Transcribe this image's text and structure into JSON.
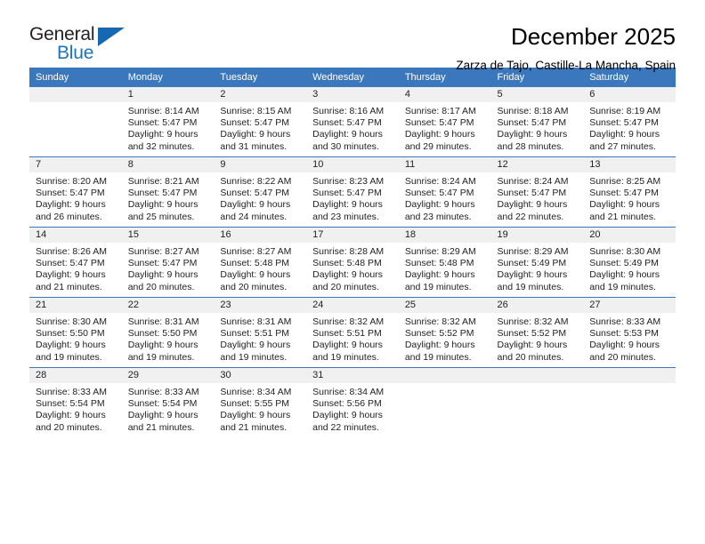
{
  "logo": {
    "primary_text": "General",
    "secondary_text": "Blue",
    "primary_color": "#231f20",
    "secondary_color": "#1b75bb",
    "triangle_color": "#1668b3"
  },
  "header": {
    "title": "December 2025",
    "subtitle": "Zarza de Tajo, Castille-La Mancha, Spain"
  },
  "theme": {
    "header_bg": "#3b77bd",
    "header_text": "#ffffff",
    "daynum_band_bg": "#f0f0f0",
    "cell_bg": "#ffffff",
    "text": "#222222"
  },
  "weekday_headers": [
    "Sunday",
    "Monday",
    "Tuesday",
    "Wednesday",
    "Thursday",
    "Friday",
    "Saturday"
  ],
  "weeks": [
    [
      {
        "day": "",
        "lines": []
      },
      {
        "day": "1",
        "lines": [
          "Sunrise: 8:14 AM",
          "Sunset: 5:47 PM",
          "Daylight: 9 hours",
          "and 32 minutes."
        ]
      },
      {
        "day": "2",
        "lines": [
          "Sunrise: 8:15 AM",
          "Sunset: 5:47 PM",
          "Daylight: 9 hours",
          "and 31 minutes."
        ]
      },
      {
        "day": "3",
        "lines": [
          "Sunrise: 8:16 AM",
          "Sunset: 5:47 PM",
          "Daylight: 9 hours",
          "and 30 minutes."
        ]
      },
      {
        "day": "4",
        "lines": [
          "Sunrise: 8:17 AM",
          "Sunset: 5:47 PM",
          "Daylight: 9 hours",
          "and 29 minutes."
        ]
      },
      {
        "day": "5",
        "lines": [
          "Sunrise: 8:18 AM",
          "Sunset: 5:47 PM",
          "Daylight: 9 hours",
          "and 28 minutes."
        ]
      },
      {
        "day": "6",
        "lines": [
          "Sunrise: 8:19 AM",
          "Sunset: 5:47 PM",
          "Daylight: 9 hours",
          "and 27 minutes."
        ]
      }
    ],
    [
      {
        "day": "7",
        "lines": [
          "Sunrise: 8:20 AM",
          "Sunset: 5:47 PM",
          "Daylight: 9 hours",
          "and 26 minutes."
        ]
      },
      {
        "day": "8",
        "lines": [
          "Sunrise: 8:21 AM",
          "Sunset: 5:47 PM",
          "Daylight: 9 hours",
          "and 25 minutes."
        ]
      },
      {
        "day": "9",
        "lines": [
          "Sunrise: 8:22 AM",
          "Sunset: 5:47 PM",
          "Daylight: 9 hours",
          "and 24 minutes."
        ]
      },
      {
        "day": "10",
        "lines": [
          "Sunrise: 8:23 AM",
          "Sunset: 5:47 PM",
          "Daylight: 9 hours",
          "and 23 minutes."
        ]
      },
      {
        "day": "11",
        "lines": [
          "Sunrise: 8:24 AM",
          "Sunset: 5:47 PM",
          "Daylight: 9 hours",
          "and 23 minutes."
        ]
      },
      {
        "day": "12",
        "lines": [
          "Sunrise: 8:24 AM",
          "Sunset: 5:47 PM",
          "Daylight: 9 hours",
          "and 22 minutes."
        ]
      },
      {
        "day": "13",
        "lines": [
          "Sunrise: 8:25 AM",
          "Sunset: 5:47 PM",
          "Daylight: 9 hours",
          "and 21 minutes."
        ]
      }
    ],
    [
      {
        "day": "14",
        "lines": [
          "Sunrise: 8:26 AM",
          "Sunset: 5:47 PM",
          "Daylight: 9 hours",
          "and 21 minutes."
        ]
      },
      {
        "day": "15",
        "lines": [
          "Sunrise: 8:27 AM",
          "Sunset: 5:47 PM",
          "Daylight: 9 hours",
          "and 20 minutes."
        ]
      },
      {
        "day": "16",
        "lines": [
          "Sunrise: 8:27 AM",
          "Sunset: 5:48 PM",
          "Daylight: 9 hours",
          "and 20 minutes."
        ]
      },
      {
        "day": "17",
        "lines": [
          "Sunrise: 8:28 AM",
          "Sunset: 5:48 PM",
          "Daylight: 9 hours",
          "and 20 minutes."
        ]
      },
      {
        "day": "18",
        "lines": [
          "Sunrise: 8:29 AM",
          "Sunset: 5:48 PM",
          "Daylight: 9 hours",
          "and 19 minutes."
        ]
      },
      {
        "day": "19",
        "lines": [
          "Sunrise: 8:29 AM",
          "Sunset: 5:49 PM",
          "Daylight: 9 hours",
          "and 19 minutes."
        ]
      },
      {
        "day": "20",
        "lines": [
          "Sunrise: 8:30 AM",
          "Sunset: 5:49 PM",
          "Daylight: 9 hours",
          "and 19 minutes."
        ]
      }
    ],
    [
      {
        "day": "21",
        "lines": [
          "Sunrise: 8:30 AM",
          "Sunset: 5:50 PM",
          "Daylight: 9 hours",
          "and 19 minutes."
        ]
      },
      {
        "day": "22",
        "lines": [
          "Sunrise: 8:31 AM",
          "Sunset: 5:50 PM",
          "Daylight: 9 hours",
          "and 19 minutes."
        ]
      },
      {
        "day": "23",
        "lines": [
          "Sunrise: 8:31 AM",
          "Sunset: 5:51 PM",
          "Daylight: 9 hours",
          "and 19 minutes."
        ]
      },
      {
        "day": "24",
        "lines": [
          "Sunrise: 8:32 AM",
          "Sunset: 5:51 PM",
          "Daylight: 9 hours",
          "and 19 minutes."
        ]
      },
      {
        "day": "25",
        "lines": [
          "Sunrise: 8:32 AM",
          "Sunset: 5:52 PM",
          "Daylight: 9 hours",
          "and 19 minutes."
        ]
      },
      {
        "day": "26",
        "lines": [
          "Sunrise: 8:32 AM",
          "Sunset: 5:52 PM",
          "Daylight: 9 hours",
          "and 20 minutes."
        ]
      },
      {
        "day": "27",
        "lines": [
          "Sunrise: 8:33 AM",
          "Sunset: 5:53 PM",
          "Daylight: 9 hours",
          "and 20 minutes."
        ]
      }
    ],
    [
      {
        "day": "28",
        "lines": [
          "Sunrise: 8:33 AM",
          "Sunset: 5:54 PM",
          "Daylight: 9 hours",
          "and 20 minutes."
        ]
      },
      {
        "day": "29",
        "lines": [
          "Sunrise: 8:33 AM",
          "Sunset: 5:54 PM",
          "Daylight: 9 hours",
          "and 21 minutes."
        ]
      },
      {
        "day": "30",
        "lines": [
          "Sunrise: 8:34 AM",
          "Sunset: 5:55 PM",
          "Daylight: 9 hours",
          "and 21 minutes."
        ]
      },
      {
        "day": "31",
        "lines": [
          "Sunrise: 8:34 AM",
          "Sunset: 5:56 PM",
          "Daylight: 9 hours",
          "and 22 minutes."
        ]
      },
      {
        "day": "",
        "lines": []
      },
      {
        "day": "",
        "lines": []
      },
      {
        "day": "",
        "lines": []
      }
    ]
  ]
}
